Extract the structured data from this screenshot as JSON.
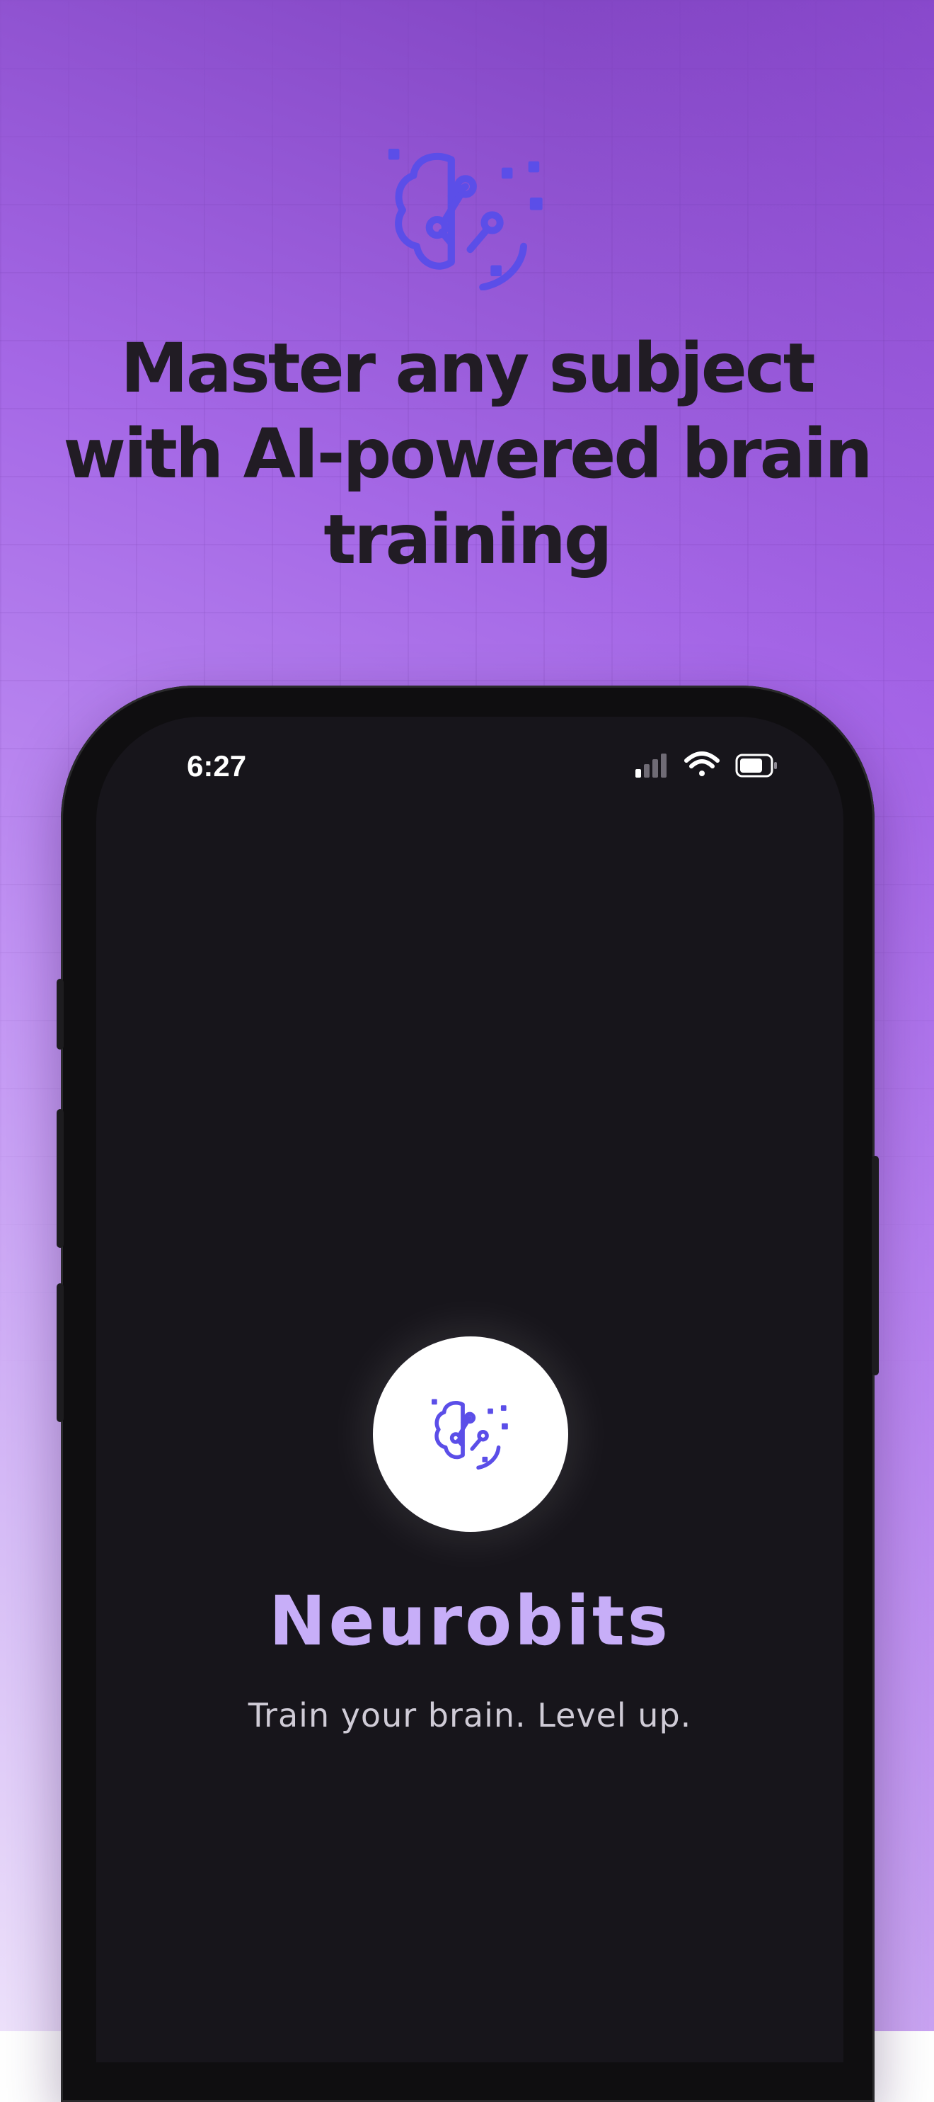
{
  "promo": {
    "headline": "Master any subject with AI-powered brain training",
    "logo_icon": "brain-circuit-icon"
  },
  "phone": {
    "status_bar": {
      "time": "6:27",
      "icons": [
        "signal-icon",
        "wifi-icon",
        "battery-icon"
      ]
    },
    "app": {
      "name": "Neurobits",
      "tagline": "Train your brain. Level up.",
      "logo_icon": "brain-circuit-icon"
    }
  },
  "colors": {
    "accent": "#5b4ee8",
    "background_gradient": [
      "#7c3fbd",
      "#c294f4",
      "#ede1fb"
    ],
    "screen": "#17151b",
    "app_name": "#c7aef8",
    "headline": "#211c24"
  }
}
